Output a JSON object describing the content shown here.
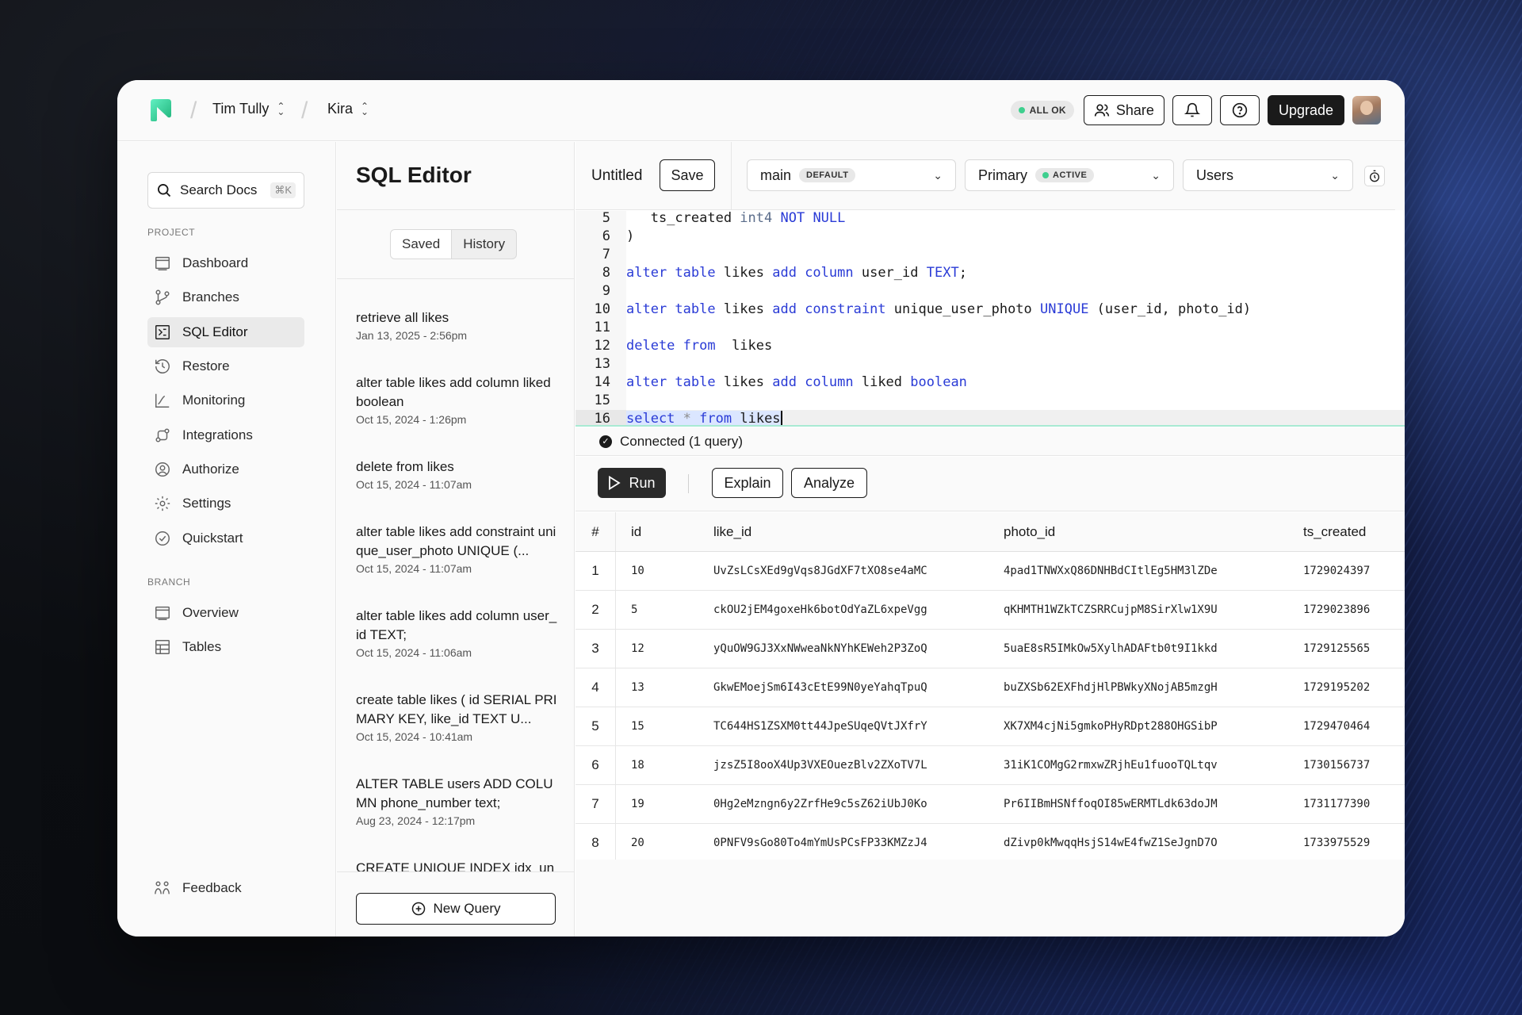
{
  "colors": {
    "accent": "#3ecf8e",
    "keyword": "#2a3bd6",
    "type": "#5a6c8a",
    "dark": "#1a1a1a"
  },
  "topbar": {
    "logo": "neon-logo-icon",
    "org": "Tim Tully",
    "project": "Kira",
    "status": "ALL OK",
    "share_label": "Share",
    "bell_icon": "bell-icon",
    "help_icon": "help-icon",
    "upgrade_label": "Upgrade"
  },
  "sidebar": {
    "search_label": "Search Docs",
    "search_shortcut": "⌘K",
    "project_label": "PROJECT",
    "project_items": [
      {
        "label": "Dashboard",
        "icon": "dashboard-icon"
      },
      {
        "label": "Branches",
        "icon": "branches-icon"
      },
      {
        "label": "SQL Editor",
        "icon": "sql-editor-icon",
        "active": true
      },
      {
        "label": "Restore",
        "icon": "restore-icon"
      },
      {
        "label": "Monitoring",
        "icon": "monitoring-icon"
      },
      {
        "label": "Integrations",
        "icon": "integrations-icon"
      },
      {
        "label": "Authorize",
        "icon": "authorize-icon"
      },
      {
        "label": "Settings",
        "icon": "settings-icon"
      },
      {
        "label": "Quickstart",
        "icon": "quickstart-icon"
      }
    ],
    "branch_label": "BRANCH",
    "branch_items": [
      {
        "label": "Overview",
        "icon": "overview-icon"
      },
      {
        "label": "Tables",
        "icon": "tables-icon"
      }
    ],
    "feedback_label": "Feedback"
  },
  "queries": {
    "title": "SQL Editor",
    "tabs": [
      "Saved",
      "History"
    ],
    "items": [
      {
        "text": "retrieve all likes",
        "date": "Jan 13, 2025 - 2:56pm"
      },
      {
        "text": "alter table likes add column liked boolean",
        "date": "Oct 15, 2024 - 1:26pm"
      },
      {
        "text": "delete from likes",
        "date": "Oct 15, 2024 - 11:07am"
      },
      {
        "text": "alter table likes add constraint unique_user_photo UNIQUE (...",
        "date": "Oct 15, 2024 - 11:07am"
      },
      {
        "text": "alter table likes add column user_id TEXT;",
        "date": "Oct 15, 2024 - 11:06am"
      },
      {
        "text": "create table likes ( id SERIAL PRIMARY KEY, like_id TEXT U...",
        "date": "Oct 15, 2024 - 10:41am"
      },
      {
        "text": "ALTER TABLE users ADD COLUMN phone_number text;",
        "date": "Aug 23, 2024 - 12:17pm"
      },
      {
        "text": "CREATE UNIQUE INDEX idx_un",
        "date": ""
      }
    ],
    "new_query_label": "New Query"
  },
  "editor": {
    "title": "Untitled",
    "save_label": "Save",
    "branch": "main",
    "branch_tag": "DEFAULT",
    "compute": "Primary",
    "compute_tag": "ACTIVE",
    "database": "Users",
    "line_numbers": [
      "5",
      "6",
      "7",
      "8",
      "9",
      "10",
      "11",
      "12",
      "13",
      "14",
      "15",
      "16"
    ],
    "connection_status": "Connected (1 query)",
    "run_label": "Run",
    "explain_label": "Explain",
    "analyze_label": "Analyze"
  },
  "results": {
    "columns": [
      "#",
      "id",
      "like_id",
      "photo_id",
      "ts_created"
    ],
    "rows": [
      [
        "1",
        "10",
        "UvZsLCsXEd9gVqs8JGdXF7tXO8se4aMC",
        "4pad1TNWXxQ86DNHBdCItlEg5HM3lZDe",
        "1729024397"
      ],
      [
        "2",
        "5",
        "ckOU2jEM4goxeHk6botOdYaZL6xpeVgg",
        "qKHMTH1WZkTCZSRRCujpM8SirXlw1X9U",
        "1729023896"
      ],
      [
        "3",
        "12",
        "yQuOW9GJ3XxNWweaNkNYhKEWeh2P3ZoQ",
        "5uaE8sR5IMkOw5XylhADAFtb0t9I1kkd",
        "1729125565"
      ],
      [
        "4",
        "13",
        "GkwEMoejSm6I43cEtE99N0yeYahqTpuQ",
        "buZXSb62EXFhdjHlPBWkyXNojAB5mzgH",
        "1729195202"
      ],
      [
        "5",
        "15",
        "TC644HS1ZSXM0tt44JpeSUqeQVtJXfrY",
        "XK7XM4cjNi5gmkoPHyRDpt288OHGSibP",
        "1729470464"
      ],
      [
        "6",
        "18",
        "jzsZ5I8ooX4Up3VXEOuezBlv2ZXoTV7L",
        "31iK1COMgG2rmxwZRjhEu1fuooTQLtqv",
        "1730156737"
      ],
      [
        "7",
        "19",
        "0Hg2eMzngn6y2ZrfHe9c5sZ62iUbJ0Ko",
        "Pr6IIBmHSNffoqOI85wERMTLdk63doJM",
        "1731177390"
      ],
      [
        "8",
        "20",
        "0PNFV9sGo80To4mYmUsPCsFP33KMZzJ4",
        "dZivp0kMwqqHsjS14wE4fwZ1SeJgnD7O",
        "1733975529"
      ]
    ]
  }
}
